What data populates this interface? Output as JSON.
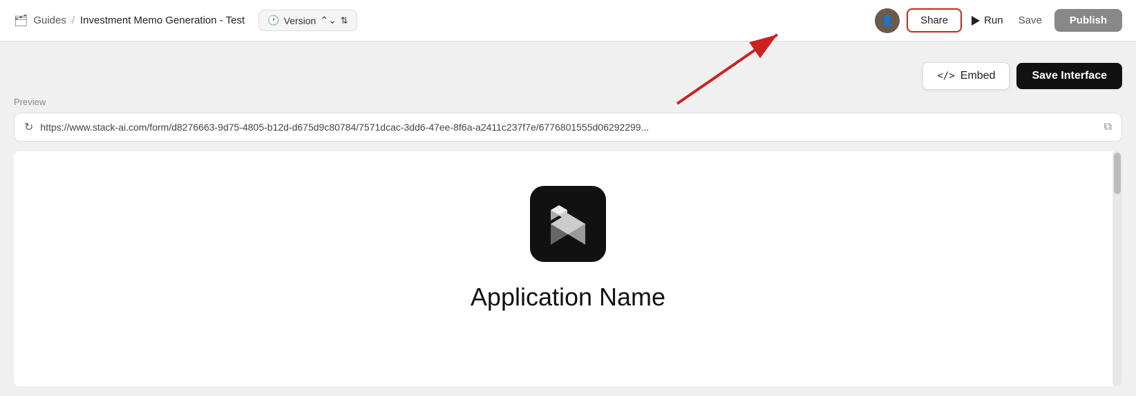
{
  "navbar": {
    "folder_icon": "📁",
    "breadcrumb_root": "Guides",
    "breadcrumb_separator": "/",
    "breadcrumb_current": "Investment Memo Generation - Test",
    "version_label": "Version",
    "share_label": "Share",
    "run_label": "Run",
    "save_label": "Save",
    "publish_label": "Publish"
  },
  "dropdown": {
    "embed_label": "Embed",
    "embed_icon": "</>",
    "save_interface_label": "Save Interface"
  },
  "preview": {
    "label": "Preview",
    "url": "https://www.stack-ai.com/form/d8276663-9d75-4805-b12d-d675d9c80784/7571dcac-3dd6-47ee-8f6a-a2411c237f7e/6776801555d06292299...",
    "app_name": "Application Name"
  },
  "colors": {
    "share_border": "#cc2222",
    "publish_bg": "#888888",
    "save_interface_bg": "#111111",
    "arrow_color": "#cc2222"
  }
}
